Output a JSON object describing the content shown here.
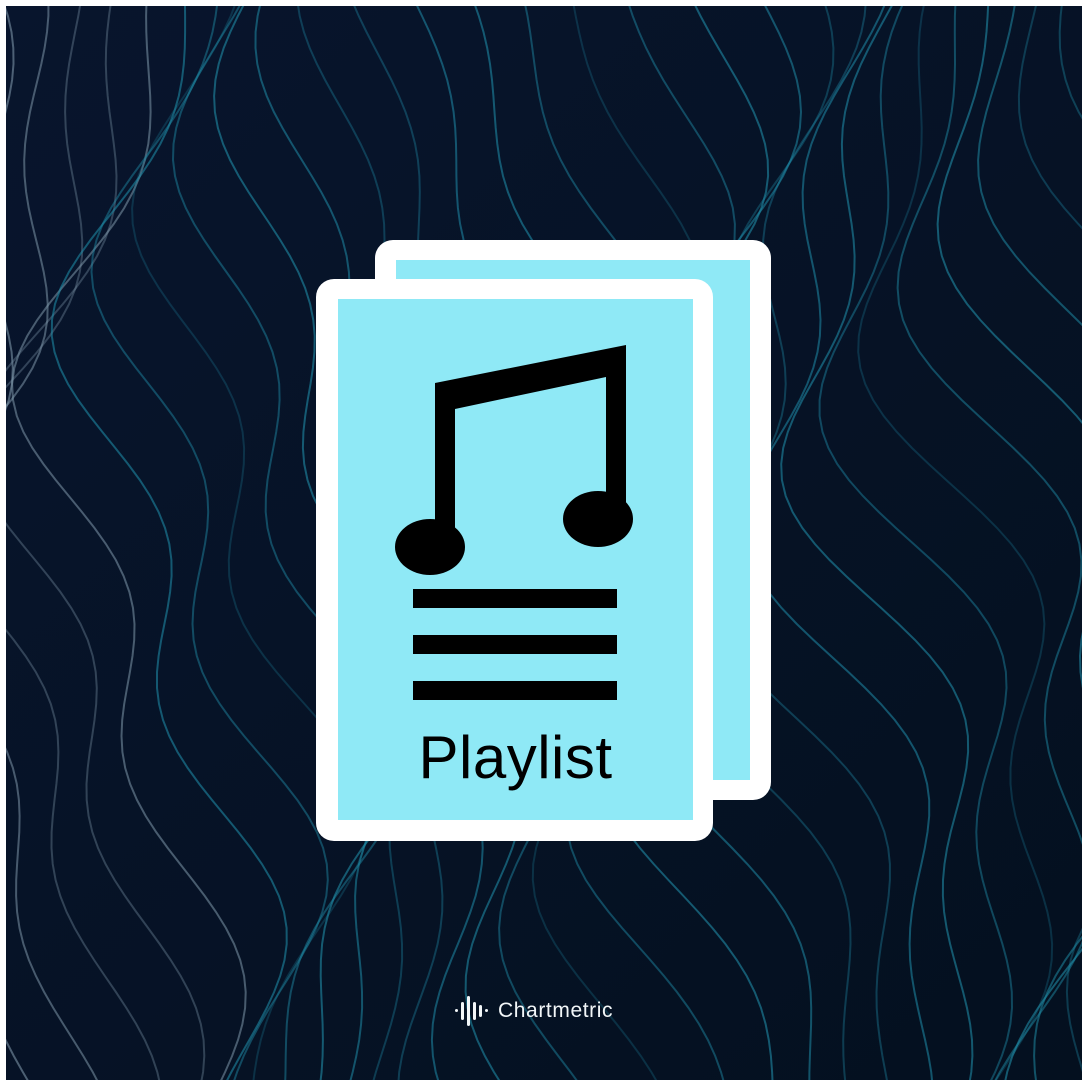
{
  "card": {
    "label": "Playlist",
    "icon": "music-note-icon"
  },
  "brand": {
    "name": "Chartmetric",
    "logo_icon": "sound-wave-logo-icon"
  },
  "colors": {
    "background": "#061127",
    "contour_line": "#1f8aa5",
    "card_fill": "#8fe9f6",
    "card_border": "#ffffff",
    "icon": "#000000",
    "brand_text": "#f2f6f8"
  }
}
